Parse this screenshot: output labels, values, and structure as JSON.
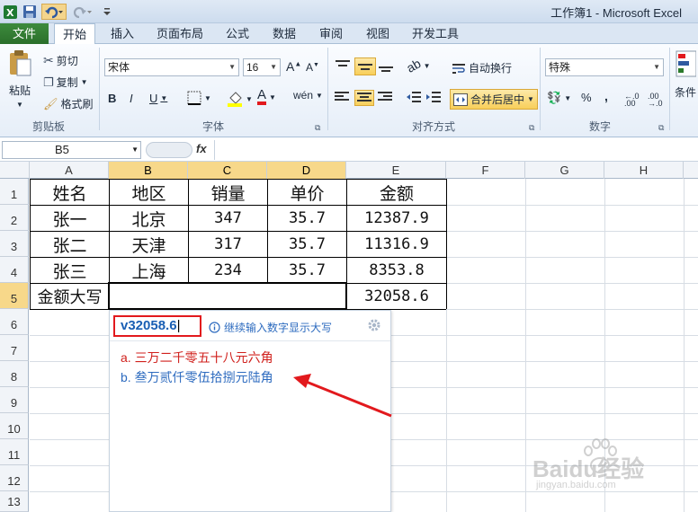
{
  "window": {
    "title": "工作簿1 - Microsoft Excel"
  },
  "tabs": [
    "文件",
    "开始",
    "插入",
    "页面布局",
    "公式",
    "数据",
    "审阅",
    "视图",
    "开发工具"
  ],
  "clipboard": {
    "paste": "粘贴",
    "cut": "剪切",
    "copy": "复制",
    "format_painter": "格式刷",
    "group": "剪贴板"
  },
  "font": {
    "name": "宋体",
    "size": "16",
    "group": "字体"
  },
  "alignment": {
    "wrap": "自动换行",
    "merge": "合并后居中",
    "group": "对齐方式"
  },
  "number": {
    "format": "特殊",
    "group": "数字"
  },
  "styles": {
    "conditional": "条件"
  },
  "formula_bar": {
    "name_box": "B5",
    "fx": "fx"
  },
  "columns": [
    "A",
    "B",
    "C",
    "D",
    "E",
    "F",
    "G",
    "H"
  ],
  "rows": [
    "1",
    "2",
    "3",
    "4",
    "5",
    "6",
    "7",
    "8",
    "9",
    "10",
    "11",
    "12",
    "13"
  ],
  "table": {
    "headers": [
      "姓名",
      "地区",
      "销量",
      "单价",
      "金额"
    ],
    "rows": [
      [
        "张一",
        "北京",
        "347",
        "35.7",
        "12387.9"
      ],
      [
        "张二",
        "天津",
        "317",
        "35.7",
        "11316.9"
      ],
      [
        "张三",
        "上海",
        "234",
        "35.7",
        "8353.8"
      ]
    ],
    "total_label": "金额大写",
    "total_value": "32058.6"
  },
  "ime": {
    "input": "v32058.6",
    "hint": "继续输入数字显示大写",
    "candidates": [
      "a. 三万二千零五十八元六角",
      "b. 叁万贰仟零伍拾捌元陆角"
    ]
  },
  "watermark": {
    "text": "Baidu经验",
    "subtext": "jingyan.baidu.com"
  },
  "colors": {
    "accent_red": "#e2191d",
    "candidate_a": "#d0201c",
    "candidate_b": "#2d6bbf",
    "select": "#f7d88a",
    "file_tab": "#2b6f2b"
  }
}
